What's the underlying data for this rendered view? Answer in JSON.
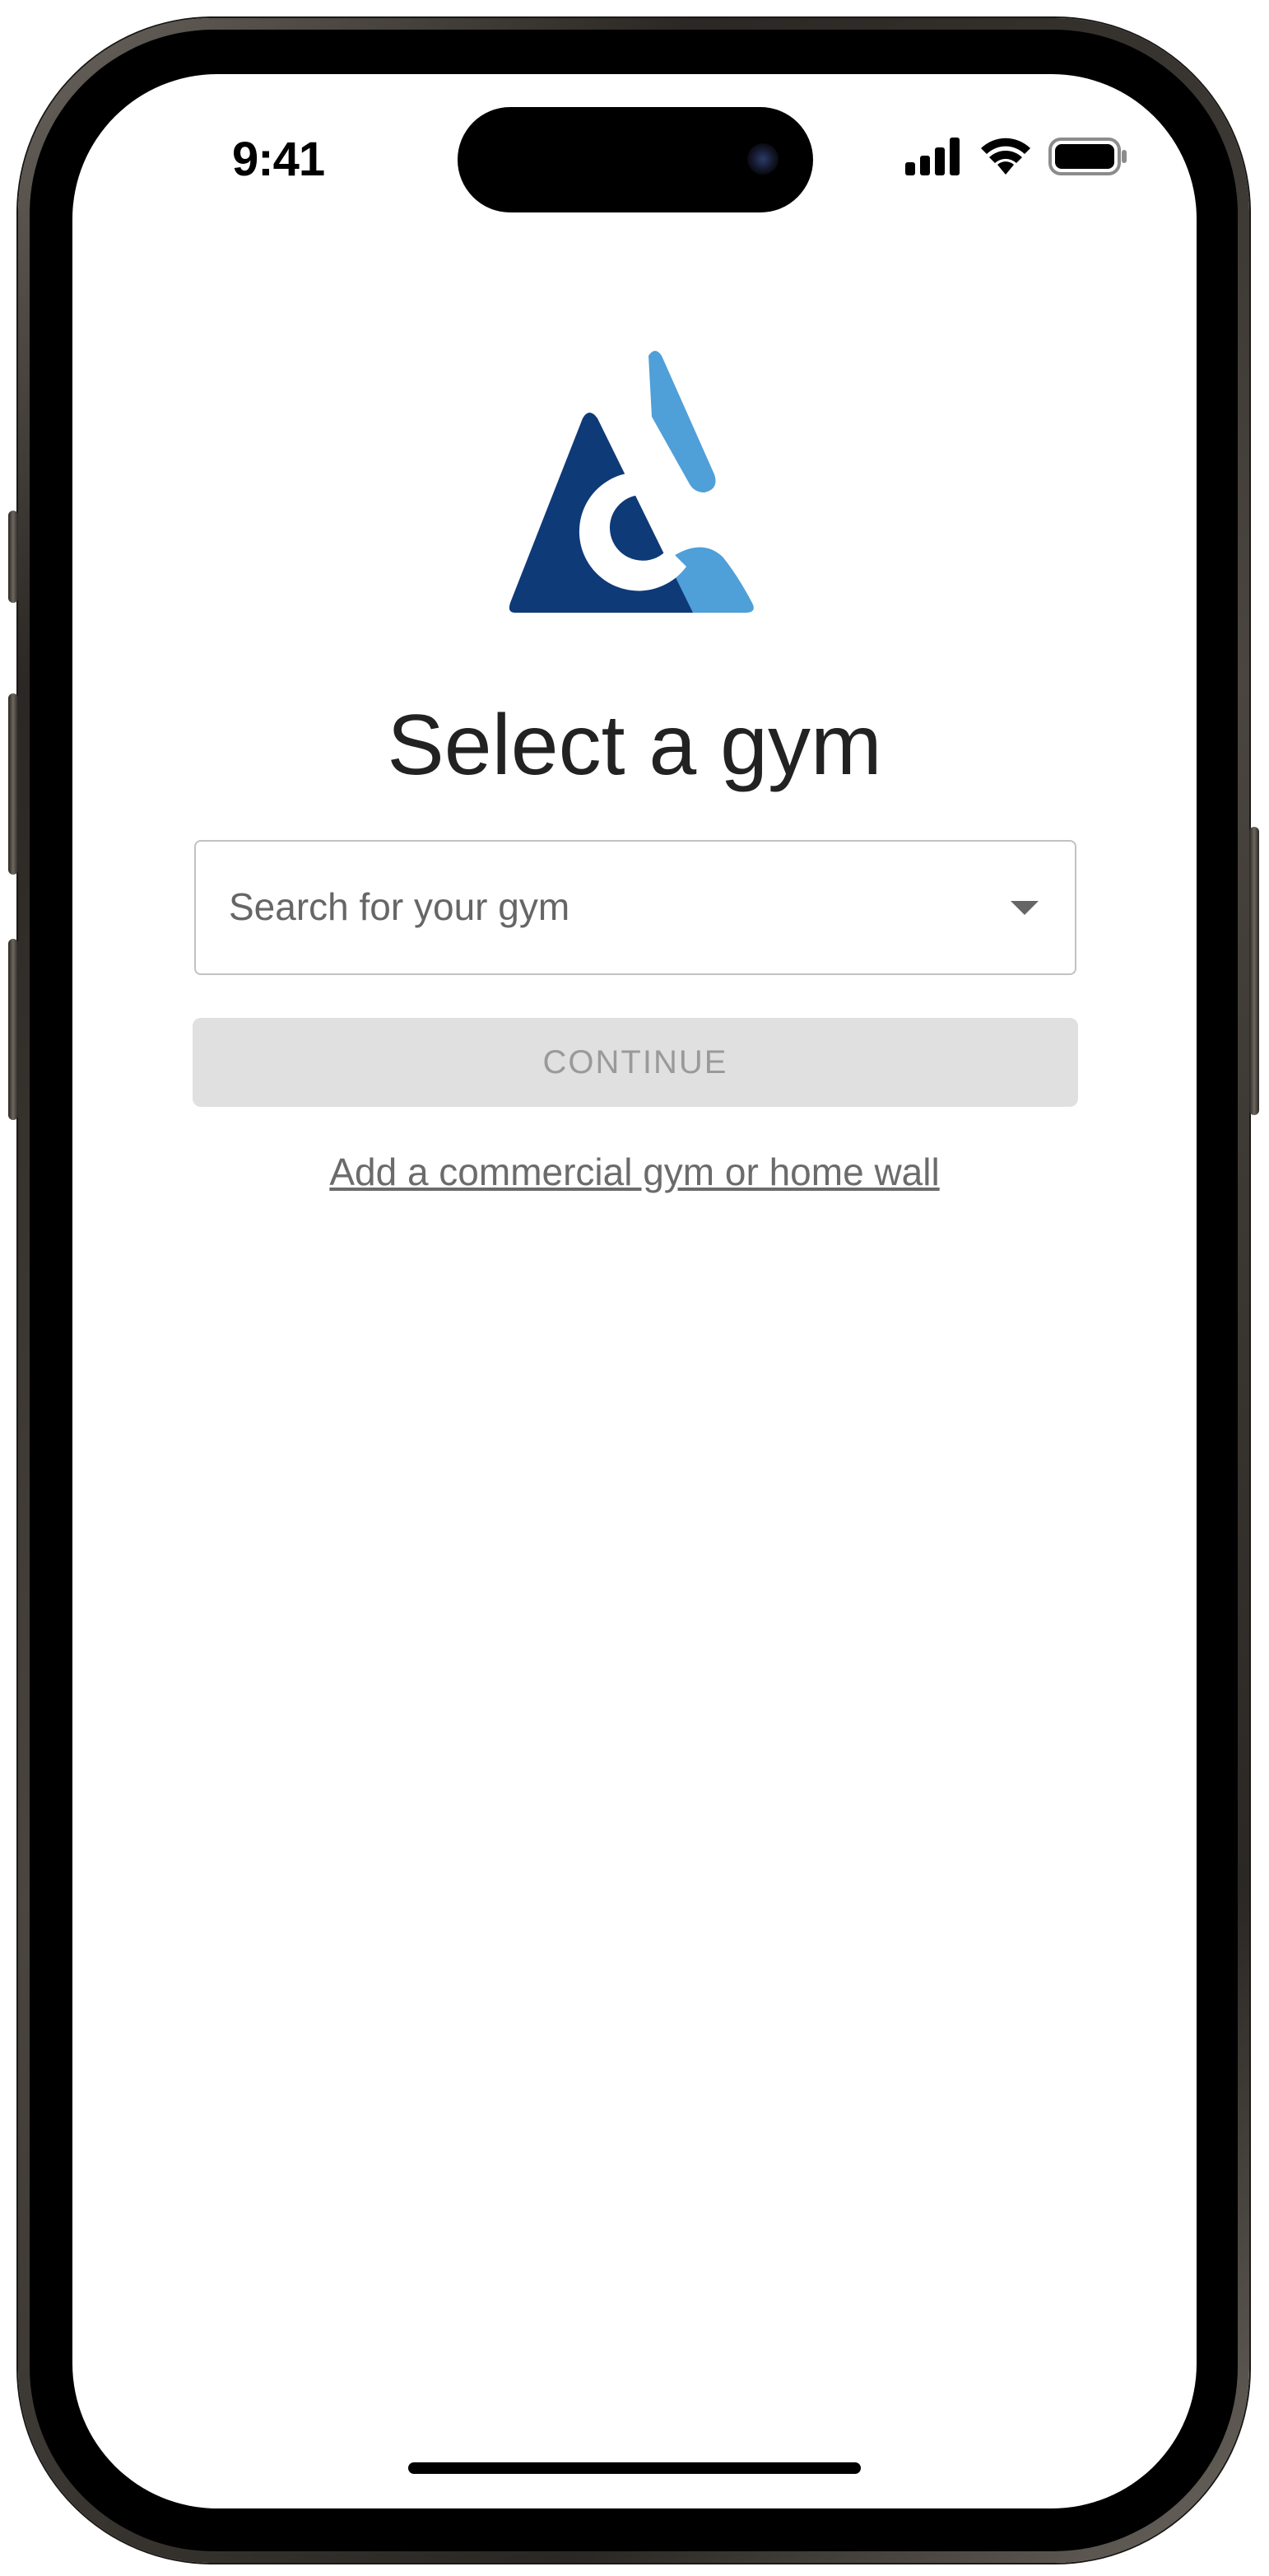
{
  "status_bar": {
    "time": "9:41",
    "icons": [
      "signal-icon",
      "wifi-icon",
      "battery-icon"
    ]
  },
  "logo": {
    "name": "climbing-app-logo",
    "colors": {
      "dark": "#0e3a78",
      "light": "#4f9fd9"
    }
  },
  "page": {
    "title": "Select a gym"
  },
  "gym_search": {
    "placeholder": "Search for your gym",
    "icon": "dropdown-caret-icon"
  },
  "actions": {
    "continue_label": "CONTINUE",
    "continue_disabled": true,
    "add_gym_link": "Add a commercial gym or home wall"
  },
  "colors": {
    "title_text": "#222222",
    "disabled_button_bg": "#e0e0e0",
    "disabled_button_text": "#9a9a9a",
    "link_text": "#6b6b6b"
  }
}
